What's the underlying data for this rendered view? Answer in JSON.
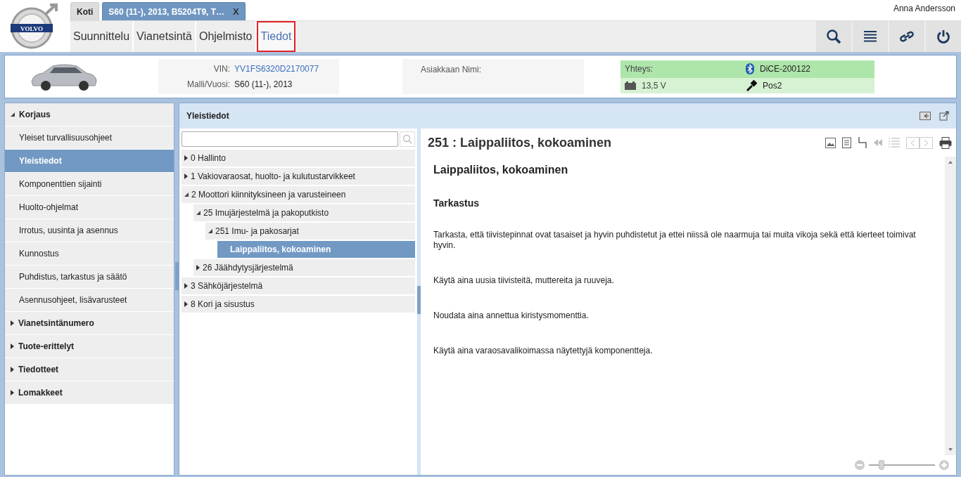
{
  "logo_text": "VOLVO",
  "user": "Anna Andersson",
  "tabs": [
    {
      "label": "Koti",
      "selected": false
    },
    {
      "label": "S60 (11-), 2013, B5204T9, T…",
      "selected": true,
      "close": "X"
    }
  ],
  "nav": [
    {
      "label": "Suunnittelu",
      "selected": false
    },
    {
      "label": "Vianetsintä",
      "selected": false
    },
    {
      "label": "Ohjelmisto",
      "selected": false
    },
    {
      "label": "Tiedot",
      "selected": true
    }
  ],
  "vehicle": {
    "vin_label": "VIN:",
    "vin": "YV1FS6320D2170077",
    "model_label": "Malli/Vuosi:",
    "model": "S60 (11-), 2013",
    "customer_label": "Asiakkaan Nimi:",
    "connection_label": "Yhteys:",
    "device": "DiCE-200122",
    "voltage": "13,5 V",
    "key_position": "Pos2"
  },
  "sidebar": [
    {
      "label": "Korjaus",
      "expanded": true,
      "items": [
        {
          "label": "Yleiset turvallisuusohjeet",
          "selected": false
        },
        {
          "label": "Yleistiedot",
          "selected": true
        },
        {
          "label": "Komponenttien sijainti",
          "selected": false
        },
        {
          "label": "Huolto-ohjelmat",
          "selected": false
        },
        {
          "label": "Irrotus, uusinta ja asennus",
          "selected": false
        },
        {
          "label": "Kunnostus",
          "selected": false
        },
        {
          "label": "Puhdistus, tarkastus ja säätö",
          "selected": false
        },
        {
          "label": "Asennusohjeet, lisävarusteet",
          "selected": false
        }
      ]
    },
    {
      "label": "Vianetsintänumero",
      "expanded": false
    },
    {
      "label": "Tuote-erittelyt",
      "expanded": false
    },
    {
      "label": "Tiedotteet",
      "expanded": false
    },
    {
      "label": "Lomakkeet",
      "expanded": false
    }
  ],
  "panel_title": "Yleistiedot",
  "tree": [
    {
      "label": "0 Hallinto",
      "expanded": false,
      "selected": false
    },
    {
      "label": "1 Vakiovaraosat, huolto- ja kulutustarvikkeet",
      "expanded": false,
      "selected": false
    },
    {
      "label": "2 Moottori kiinnityksineen ja varusteineen",
      "expanded": true,
      "selected": false,
      "children": [
        {
          "label": "25 Imujärjestelmä ja pakoputkisto",
          "expanded": true,
          "selected": false,
          "children": [
            {
              "label": "251 Imu- ja pakosarjat",
              "expanded": true,
              "selected": false,
              "children": [
                {
                  "label": "Laippaliitos, kokoaminen",
                  "selected": true
                }
              ]
            }
          ]
        },
        {
          "label": "26 Jäähdytysjärjestelmä",
          "expanded": false,
          "selected": false
        }
      ]
    },
    {
      "label": "3 Sähköjärjestelmä",
      "expanded": false,
      "selected": false
    },
    {
      "label": "8 Kori ja sisustus",
      "expanded": false,
      "selected": false
    }
  ],
  "document": {
    "title": "251 : Laippaliitos, kokoaminen",
    "heading": "Laippaliitos, kokoaminen",
    "subheading": "Tarkastus",
    "paragraphs": [
      "Tarkasta, että tiivistepinnat ovat tasaiset ja hyvin puhdistetut ja ettei niissä ole naarmuja tai muita vikoja sekä että kierteet toimivat hyvin.",
      "Käytä aina uusia tiivisteitä, muttereita ja ruuveja.",
      "Noudata aina annettua kiristysmomenttia.",
      "Käytä aina varaosavalikoimassa näytettyjä komponentteja."
    ]
  },
  "zoom": {
    "level": 0.15
  }
}
